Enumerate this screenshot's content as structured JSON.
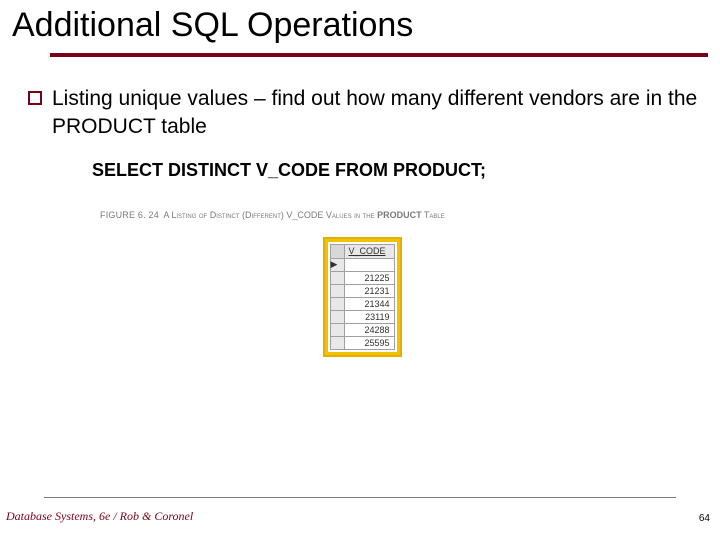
{
  "title": "Additional SQL Operations",
  "bullet": "Listing unique values – find out how many different vendors are in the PRODUCT table",
  "sql": "SELECT DISTINCT V_CODE FROM PRODUCT;",
  "figure": {
    "label": "FIGURE 6. 24",
    "caption_prefix": "A Listing of Distinct (Different) V_CODE Values in the ",
    "caption_bold": "PRODUCT",
    "caption_suffix": " Table"
  },
  "table": {
    "header": "V_CODE",
    "arrow": "▶",
    "rows": [
      "",
      "21225",
      "21231",
      "21344",
      "23119",
      "24288",
      "25595"
    ]
  },
  "footer": "Database Systems, 6e / Rob & Coronel",
  "page": "64"
}
